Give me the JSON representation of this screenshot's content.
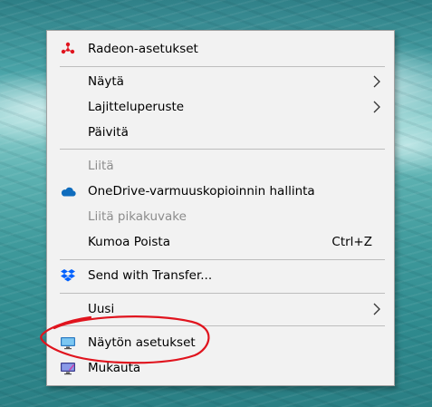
{
  "context_menu": {
    "radeon": {
      "label": "Radeon-asetukset",
      "icon": "radeon-icon"
    },
    "view": {
      "label": "Näytä"
    },
    "sort_by": {
      "label": "Lajitteluperuste"
    },
    "refresh": {
      "label": "Päivitä"
    },
    "paste": {
      "label": "Liitä",
      "disabled": true
    },
    "onedrive": {
      "label": "OneDrive-varmuuskopioinnin hallinta",
      "icon": "onedrive-cloud-icon"
    },
    "paste_shortcut": {
      "label": "Liitä pikakuvake",
      "disabled": true
    },
    "undo_delete": {
      "label": "Kumoa Poista",
      "shortcut": "Ctrl+Z"
    },
    "send_with_transfer": {
      "label": "Send with Transfer...",
      "icon": "dropbox-icon"
    },
    "new": {
      "label": "Uusi"
    },
    "display_settings": {
      "label": "Näytön asetukset",
      "icon": "display-icon"
    },
    "personalize": {
      "label": "Mukauta",
      "icon": "personalize-icon"
    }
  },
  "annotation": {
    "color": "#e0141e"
  },
  "colors": {
    "menu_bg": "#f2f2f2",
    "disabled_text": "#8c8c8c",
    "radeon_red": "#e0141e",
    "onedrive_blue": "#0f6cbd",
    "dropbox_blue": "#0061fe"
  }
}
